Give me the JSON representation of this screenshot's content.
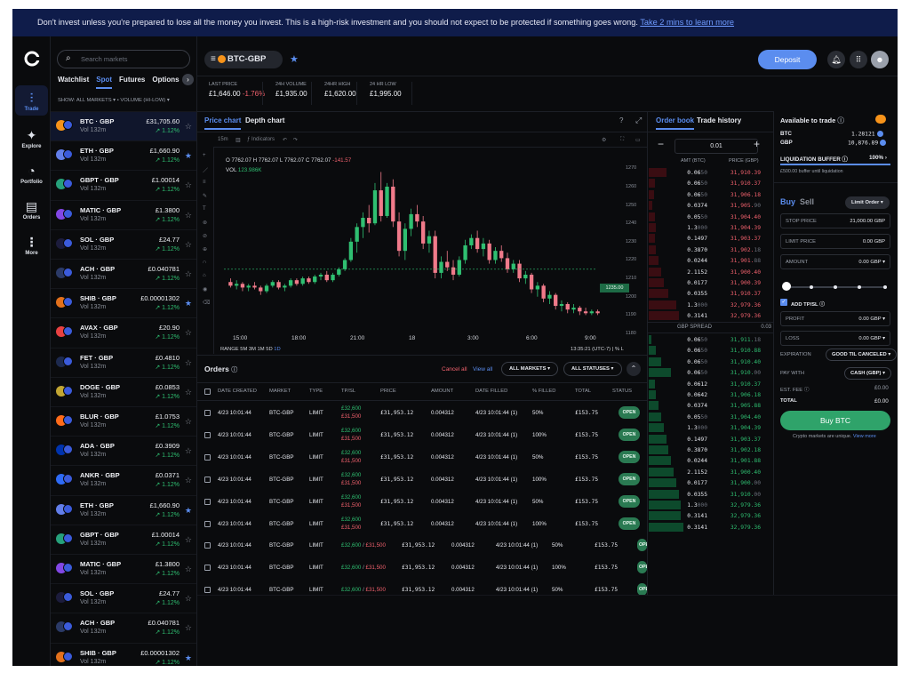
{
  "banner": {
    "text": "Don't invest unless you're prepared to lose all the money you invest. This is a high-risk investment and you should not expect to be protected if something goes wrong. ",
    "link": "Take 2 mins to learn more"
  },
  "rail": {
    "items": [
      {
        "label": "Trade",
        "icon": "trade-icon"
      },
      {
        "label": "Explore",
        "icon": "explore-icon"
      },
      {
        "label": "Portfolio",
        "icon": "portfolio-icon"
      },
      {
        "label": "Orders",
        "icon": "orders-icon"
      },
      {
        "label": "More",
        "icon": "more-icon"
      }
    ]
  },
  "markets": {
    "search_placeholder": "Search markets",
    "tabs": [
      "Watchlist",
      "Spot",
      "Futures",
      "Options"
    ],
    "active_tab": "Spot",
    "filter": "SHOW: ALL MARKETS ▾  •  VOLUME (HI-LOW) ▾",
    "rows": [
      {
        "name": "BTC · GBP",
        "vol": "Vol 132m",
        "price": "£31,705.60",
        "chg": "↗ 1.12%",
        "color": "#f7931a",
        "starred": false,
        "selected": true
      },
      {
        "name": "ETH · GBP",
        "vol": "Vol 132m",
        "price": "£1,660.90",
        "chg": "↗ 1.12%",
        "color": "#627eea",
        "starred": true,
        "selected": false
      },
      {
        "name": "GBPT · GBP",
        "vol": "Vol 132m",
        "price": "£1.00014",
        "chg": "↗ 1.12%",
        "color": "#26a17b",
        "starred": false,
        "selected": false
      },
      {
        "name": "MATIC · GBP",
        "vol": "Vol 132m",
        "price": "£1.3800",
        "chg": "↗ 1.12%",
        "color": "#8247e5",
        "starred": false,
        "selected": false
      },
      {
        "name": "SOL · GBP",
        "vol": "Vol 132m",
        "price": "£24.77",
        "chg": "↗ 1.12%",
        "color": "#1c1c3c",
        "starred": false,
        "selected": false
      },
      {
        "name": "ACH · GBP",
        "vol": "Vol 132m",
        "price": "£0.040781",
        "chg": "↗ 1.12%",
        "color": "#2b3a67",
        "starred": false,
        "selected": false
      },
      {
        "name": "SHIB · GBP",
        "vol": "Vol 132m",
        "price": "£0.00001302",
        "chg": "↗ 1.12%",
        "color": "#e3711c",
        "starred": true,
        "selected": false
      },
      {
        "name": "AVAX · GBP",
        "vol": "Vol 132m",
        "price": "£20.90",
        "chg": "↗ 1.12%",
        "color": "#e84142",
        "starred": false,
        "selected": false
      },
      {
        "name": "FET · GBP",
        "vol": "Vol 132m",
        "price": "£0.4810",
        "chg": "↗ 1.12%",
        "color": "#1d2a4f",
        "starred": false,
        "selected": false
      },
      {
        "name": "DOGE · GBP",
        "vol": "Vol 132m",
        "price": "£0.0853",
        "chg": "↗ 1.12%",
        "color": "#c2a633",
        "starred": false,
        "selected": false
      },
      {
        "name": "BLUR · GBP",
        "vol": "Vol 132m",
        "price": "£1.0753",
        "chg": "↗ 1.12%",
        "color": "#ff6b1a",
        "starred": false,
        "selected": false
      },
      {
        "name": "ADA · GBP",
        "vol": "Vol 132m",
        "price": "£0.3909",
        "chg": "↗ 1.12%",
        "color": "#0033ad",
        "starred": false,
        "selected": false
      },
      {
        "name": "ANKR · GBP",
        "vol": "Vol 132m",
        "price": "£0.0371",
        "chg": "↗ 1.12%",
        "color": "#2e6bf6",
        "starred": false,
        "selected": false
      },
      {
        "name": "ETH · GBP",
        "vol": "Vol 132m",
        "price": "£1,660.90",
        "chg": "↗ 1.12%",
        "color": "#627eea",
        "starred": true,
        "selected": false
      },
      {
        "name": "GBPT · GBP",
        "vol": "Vol 132m",
        "price": "£1.00014",
        "chg": "↗ 1.12%",
        "color": "#26a17b",
        "starred": false,
        "selected": false
      },
      {
        "name": "MATIC · GBP",
        "vol": "Vol 132m",
        "price": "£1.3800",
        "chg": "↗ 1.12%",
        "color": "#8247e5",
        "starred": false,
        "selected": false
      },
      {
        "name": "SOL · GBP",
        "vol": "Vol 132m",
        "price": "£24.77",
        "chg": "↗ 1.12%",
        "color": "#1c1c3c",
        "starred": false,
        "selected": false
      },
      {
        "name": "ACH · GBP",
        "vol": "Vol 132m",
        "price": "£0.040781",
        "chg": "↗ 1.12%",
        "color": "#2b3a67",
        "starred": false,
        "selected": false
      },
      {
        "name": "SHIB · GBP",
        "vol": "Vol 132m",
        "price": "£0.00001302",
        "chg": "↗ 1.12%",
        "color": "#e3711c",
        "starred": true,
        "selected": false
      }
    ]
  },
  "header": {
    "pair": "BTC-GBP",
    "deposit": "Deposit",
    "stats": [
      {
        "label": "LAST PRICE",
        "value": "£1,646.00",
        "change": "-1.76%"
      },
      {
        "label": "24H VOLUME",
        "value": "£1,935.00",
        "change": ""
      },
      {
        "label": "24HR HIGH",
        "value": "£1,620.00",
        "change": ""
      },
      {
        "label": "24 HR LOW",
        "value": "£1,995.00",
        "change": ""
      }
    ]
  },
  "chart": {
    "tabs": [
      "Price chart",
      "Depth chart"
    ],
    "toolbar": {
      "interval": "15m",
      "indicators": "Indicators"
    },
    "ohlc": "O 7762.07  H 7762.07  L 7762.07  C 7762.07",
    "ohlc_change": "-141.57",
    "vol_label": "VOL",
    "vol_value": "123.986K",
    "current_price": "1235.00",
    "range_text": "RANGE  5M  3M  1M  5D  ",
    "range_active": "1D",
    "utc": "13:35:21 (UTC-7)  |  %  L"
  },
  "chart_data": {
    "type": "candlestick",
    "x_ticks": [
      "15:00",
      "18:00",
      "21:00",
      "18",
      "3:00",
      "6:00",
      "9:00"
    ],
    "y_ticks": [
      1270,
      1260,
      1250,
      1240,
      1230,
      1220,
      1210,
      1200,
      1190,
      1180
    ],
    "ylim": [
      1180,
      1275
    ],
    "candles": [
      [
        1208,
        1210,
        1205,
        1206
      ],
      [
        1206,
        1209,
        1204,
        1207
      ],
      [
        1207,
        1208,
        1203,
        1205
      ],
      [
        1205,
        1207,
        1203,
        1206
      ],
      [
        1206,
        1208,
        1204,
        1205
      ],
      [
        1205,
        1206,
        1201,
        1203
      ],
      [
        1203,
        1207,
        1202,
        1206
      ],
      [
        1206,
        1209,
        1205,
        1208
      ],
      [
        1208,
        1209,
        1204,
        1205
      ],
      [
        1205,
        1207,
        1203,
        1206
      ],
      [
        1206,
        1210,
        1205,
        1209
      ],
      [
        1209,
        1210,
        1206,
        1207
      ],
      [
        1207,
        1211,
        1206,
        1210
      ],
      [
        1210,
        1211,
        1207,
        1208
      ],
      [
        1208,
        1212,
        1207,
        1211
      ],
      [
        1211,
        1213,
        1209,
        1212
      ],
      [
        1212,
        1214,
        1208,
        1209
      ],
      [
        1209,
        1213,
        1208,
        1212
      ],
      [
        1212,
        1216,
        1211,
        1215
      ],
      [
        1215,
        1221,
        1214,
        1220
      ],
      [
        1220,
        1232,
        1219,
        1230
      ],
      [
        1230,
        1240,
        1224,
        1238
      ],
      [
        1238,
        1246,
        1232,
        1243
      ],
      [
        1243,
        1250,
        1235,
        1240
      ],
      [
        1240,
        1262,
        1239,
        1258
      ],
      [
        1258,
        1268,
        1241,
        1244
      ],
      [
        1244,
        1262,
        1243,
        1260
      ],
      [
        1260,
        1264,
        1238,
        1241
      ],
      [
        1241,
        1246,
        1222,
        1225
      ],
      [
        1225,
        1240,
        1220,
        1237
      ],
      [
        1237,
        1248,
        1233,
        1245
      ],
      [
        1245,
        1250,
        1238,
        1241
      ],
      [
        1241,
        1244,
        1226,
        1229
      ],
      [
        1229,
        1236,
        1224,
        1233
      ],
      [
        1233,
        1236,
        1210,
        1213
      ],
      [
        1213,
        1222,
        1210,
        1219
      ],
      [
        1219,
        1225,
        1214,
        1216
      ],
      [
        1216,
        1220,
        1209,
        1212
      ],
      [
        1212,
        1222,
        1211,
        1220
      ],
      [
        1220,
        1231,
        1218,
        1228
      ],
      [
        1228,
        1234,
        1226,
        1232
      ],
      [
        1232,
        1236,
        1224,
        1226
      ],
      [
        1226,
        1232,
        1222,
        1229
      ],
      [
        1229,
        1231,
        1218,
        1220
      ],
      [
        1220,
        1227,
        1218,
        1225
      ],
      [
        1225,
        1228,
        1219,
        1221
      ],
      [
        1221,
        1224,
        1213,
        1215
      ],
      [
        1215,
        1220,
        1213,
        1218
      ],
      [
        1218,
        1220,
        1208,
        1210
      ],
      [
        1210,
        1214,
        1207,
        1212
      ],
      [
        1212,
        1213,
        1202,
        1204
      ],
      [
        1204,
        1208,
        1200,
        1206
      ],
      [
        1206,
        1207,
        1197,
        1199
      ],
      [
        1199,
        1203,
        1196,
        1201
      ],
      [
        1201,
        1202,
        1193,
        1195
      ],
      [
        1195,
        1198,
        1192,
        1196
      ],
      [
        1196,
        1197,
        1191,
        1193
      ],
      [
        1193,
        1196,
        1191,
        1194
      ],
      [
        1194,
        1195,
        1190,
        1192
      ],
      [
        1192,
        1194,
        1190,
        1191
      ],
      [
        1191,
        1193,
        1190,
        1192
      ],
      [
        1192,
        1193,
        1190,
        1191
      ]
    ]
  },
  "orders": {
    "title": "Orders",
    "cancel_all": "Cancel all",
    "view_all": "View all",
    "filter_markets": "ALL MARKETS",
    "filter_statuses": "ALL STATUSES",
    "columns": [
      "DATE CREATED",
      "MARKET",
      "TYPE",
      "TP/SL",
      "PRICE",
      "AMOUNT",
      "DATE FILLED",
      "% FILLED",
      "TOTAL",
      "STATUS"
    ],
    "rows": [
      {
        "date": "4/23 10:01:44",
        "market": "BTC-GBP",
        "type": "LIMIT",
        "tp": "£32,600",
        "sl": "£31,500",
        "price": "£31,953.12",
        "amount": "0.004312",
        "filled_date": "4/23 10:01:44 (1)",
        "pct": "50%",
        "total": "£153.75",
        "status": "OPEN"
      },
      {
        "date": "4/23 10:01:44",
        "market": "BTC-GBP",
        "type": "LIMIT",
        "tp": "£32,600",
        "sl": "£31,500",
        "price": "£31,953.12",
        "amount": "0.004312",
        "filled_date": "4/23 10:01:44 (1)",
        "pct": "100%",
        "total": "£153.75",
        "status": "OPEN"
      },
      {
        "date": "4/23 10:01:44",
        "market": "BTC-GBP",
        "type": "LIMIT",
        "tp": "£32,600",
        "sl": "£31,500",
        "price": "£31,953.12",
        "amount": "0.004312",
        "filled_date": "4/23 10:01:44 (1)",
        "pct": "50%",
        "total": "£153.75",
        "status": "OPEN"
      },
      {
        "date": "4/23 10:01:44",
        "market": "BTC-GBP",
        "type": "LIMIT",
        "tp": "£32,600",
        "sl": "£31,500",
        "price": "£31,953.12",
        "amount": "0.004312",
        "filled_date": "4/23 10:01:44 (1)",
        "pct": "100%",
        "total": "£153.75",
        "status": "OPEN"
      },
      {
        "date": "4/23 10:01:44",
        "market": "BTC-GBP",
        "type": "LIMIT",
        "tp": "£32,600",
        "sl": "£31,500",
        "price": "£31,953.12",
        "amount": "0.004312",
        "filled_date": "4/23 10:01:44 (1)",
        "pct": "50%",
        "total": "£153.75",
        "status": "OPEN"
      },
      {
        "date": "4/23 10:01:44",
        "market": "BTC-GBP",
        "type": "LIMIT",
        "tp": "£32,600",
        "sl": "£31,500",
        "price": "£31,953.12",
        "amount": "0.004312",
        "filled_date": "4/23 10:01:44 (1)",
        "pct": "100%",
        "total": "£153.75",
        "status": "OPEN"
      }
    ],
    "rows_inline": [
      {
        "date": "4/23 10:01:44",
        "market": "BTC-GBP",
        "type": "LIMIT",
        "tp": "£32,600",
        "sl": "£31,500",
        "price": "£31,953.12",
        "amount": "0.004312",
        "filled_date": "4/23 10:01:44 (1)",
        "pct": "50%",
        "total": "£153.75",
        "status": "OPEN"
      },
      {
        "date": "4/23 10:01:44",
        "market": "BTC-GBP",
        "type": "LIMIT",
        "tp": "£32,600",
        "sl": "£31,500",
        "price": "£31,953.12",
        "amount": "0.004312",
        "filled_date": "4/23 10:01:44 (1)",
        "pct": "100%",
        "total": "£153.75",
        "status": "OPEN"
      },
      {
        "date": "4/23 10:01:44",
        "market": "BTC-GBP",
        "type": "LIMIT",
        "tp": "£32,600",
        "sl": "£31,500",
        "price": "£31,953.12",
        "amount": "0.004312",
        "filled_date": "4/23 10:01:44 (1)",
        "pct": "50%",
        "total": "£153.75",
        "status": "OPEN"
      }
    ]
  },
  "orderbook": {
    "tabs": [
      "Order book",
      "Trade history"
    ],
    "increment": "0.01",
    "col_amt": "AMT (BTC)",
    "col_price": "PRICE (GBP)",
    "spread_label": "GBP SPREAD",
    "spread_value": "0.03",
    "asks": [
      {
        "amt": "0.06",
        "dim": "50",
        "price": "31,910.39",
        "depth": 0.14
      },
      {
        "amt": "0.06",
        "dim": "50",
        "price": "31,910.37",
        "depth": 0.05
      },
      {
        "amt": "0.06",
        "dim": "50",
        "price": "31,906.18",
        "depth": 0.04
      },
      {
        "amt": "0.0374",
        "dim": "",
        "price": "31,905.",
        "dim2": "90",
        "depth": 0.03
      },
      {
        "amt": "0.05",
        "dim": "50",
        "price": "31,904.40",
        "depth": 0.05
      },
      {
        "amt": "1.3",
        "dim": "000",
        "price": "31,904.39",
        "depth": 0.06
      },
      {
        "amt": "0.1497",
        "dim": "",
        "price": "31,903.37",
        "depth": 0.05
      },
      {
        "amt": "0.3870",
        "dim": "",
        "price": "31,902.",
        "dim2": "18",
        "depth": 0.06
      },
      {
        "amt": "0.0244",
        "dim": "",
        "price": "31,901.",
        "dim2": "88",
        "depth": 0.08
      },
      {
        "amt": "2.1152",
        "dim": "",
        "price": "31,900.40",
        "depth": 0.1
      },
      {
        "amt": "0.0177",
        "dim": "",
        "price": "31,900.39",
        "depth": 0.12
      },
      {
        "amt": "0.0355",
        "dim": "",
        "price": "31,910.37",
        "depth": 0.16
      },
      {
        "amt": "1.3",
        "dim": "000",
        "price": "32,979.36",
        "depth": 0.22
      },
      {
        "amt": "0.3141",
        "dim": "",
        "price": "32,979.36",
        "depth": 0.24
      }
    ],
    "bids": [
      {
        "amt": "0.06",
        "dim": "50",
        "price": "31,911.",
        "dim2": "18",
        "depth": 0.02
      },
      {
        "amt": "0.06",
        "dim": "50",
        "price": "31,910.88",
        "depth": 0.06
      },
      {
        "amt": "0.06",
        "dim": "50",
        "price": "31,910.40",
        "depth": 0.1
      },
      {
        "amt": "0.06",
        "dim": "50",
        "price": "31,910.",
        "dim2": "00",
        "depth": 0.18
      },
      {
        "amt": "0.0612",
        "dim": "",
        "price": "31,910.37",
        "depth": 0.05
      },
      {
        "amt": "0.0642",
        "dim": "",
        "price": "31,906.18",
        "depth": 0.06
      },
      {
        "amt": "0.0374",
        "dim": "",
        "price": "31,905.88",
        "depth": 0.08
      },
      {
        "amt": "0.05",
        "dim": "50",
        "price": "31,904.40",
        "depth": 0.1
      },
      {
        "amt": "1.3",
        "dim": "000",
        "price": "31,904.39",
        "depth": 0.12
      },
      {
        "amt": "0.1497",
        "dim": "",
        "price": "31,903.37",
        "depth": 0.14
      },
      {
        "amt": "0.3870",
        "dim": "",
        "price": "31,902.18",
        "depth": 0.16
      },
      {
        "amt": "0.0244",
        "dim": "",
        "price": "31,901.88",
        "depth": 0.18
      },
      {
        "amt": "2.1152",
        "dim": "",
        "price": "31,900.40",
        "depth": 0.2
      },
      {
        "amt": "0.0177",
        "dim": "",
        "price": "31,900.",
        "dim2": "00",
        "depth": 0.22
      },
      {
        "amt": "0.0355",
        "dim": "",
        "price": "31,910.",
        "dim2": "00",
        "depth": 0.24
      },
      {
        "amt": "1.3",
        "dim": "000",
        "price": "32,979.36",
        "depth": 0.26
      },
      {
        "amt": "0.3141",
        "dim": "",
        "price": "32,979.36",
        "depth": 0.26
      },
      {
        "amt": "0.3141",
        "dim": "",
        "price": "32,979.36",
        "depth": 0.28
      }
    ]
  },
  "trade": {
    "title": "Available to trade",
    "btc_label": "BTC",
    "btc_value": "1.28121",
    "gbp_label": "GBP",
    "gbp_value": "10,876.89",
    "liq_label": "LIQUIDATION BUFFER",
    "liq_value": "100%",
    "liq_note": "£500.00 buffer until liquidation",
    "liq_fill": 1.0,
    "buy_tab": "Buy",
    "sell_tab": "Sell",
    "order_type": "Limit Order",
    "stop_label": "STOP PRICE",
    "stop_value": "21,000.00",
    "stop_unit": "GBP",
    "limit_label": "LIMIT PRICE",
    "limit_value": "0.00",
    "limit_unit": "GBP",
    "amount_label": "AMOUNT",
    "amount_value": "0.00",
    "amount_unit": "GBP",
    "slider_value": 0.0,
    "tpsl_label": "ADD TP/SL",
    "profit_label": "PROFIT",
    "profit_value": "0.00",
    "profit_unit": "GBP",
    "loss_label": "LOSS",
    "loss_value": "0.00",
    "loss_unit": "GBP",
    "exp_label": "EXPIRATION",
    "exp_value": "GOOD TIL CANCELED",
    "pay_label": "PAY WITH",
    "pay_value": "CASH (GBP)",
    "fee_label": "EST. FEE",
    "fee_value": "£0.00",
    "total_label": "TOTAL",
    "total_value": "£0.00",
    "buy_button": "Buy BTC",
    "note": "Crypto markets are unique. ",
    "note_link": "View more"
  }
}
